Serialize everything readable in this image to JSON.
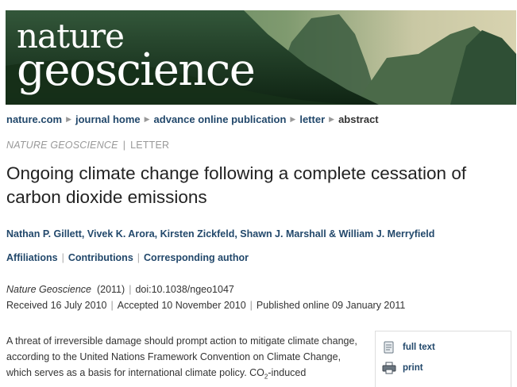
{
  "banner": {
    "logo_line1": "nature",
    "logo_line2": "geoscience"
  },
  "breadcrumb": [
    "nature.com",
    "journal home",
    "advance online publication",
    "letter",
    "abstract"
  ],
  "article": {
    "journal": "NATURE GEOSCIENCE",
    "type": "LETTER",
    "title": "Ongoing climate change following a complete cessation of carbon dioxide emissions",
    "authors": "Nathan P. Gillett, Vivek K. Arora, Kirsten Zickfeld, Shawn J. Marshall & William J. Merryfield",
    "links": [
      "Affiliations",
      "Contributions",
      "Corresponding author"
    ],
    "citation_journal": "Nature Geoscience",
    "citation_year": "(2011)",
    "doi": "doi:10.1038/ngeo1047",
    "received": "Received  16 July 2010",
    "accepted": "Accepted  10 November 2010",
    "published": "Published online  09 January 2011",
    "abstract_text": "A threat of irreversible damage should prompt action to mitigate climate change, according to the United Nations Framework Convention on Climate Change, which serves as a basis for international climate policy. CO",
    "abstract_sub": "2",
    "abstract_tail": "-induced"
  },
  "tools": {
    "full_text": "full text",
    "print": "print",
    "full_text_icon": "document-icon",
    "print_icon": "printer-icon"
  },
  "colors": {
    "link": "#22486b",
    "muted": "#999999",
    "banner_green": "#27482c"
  }
}
